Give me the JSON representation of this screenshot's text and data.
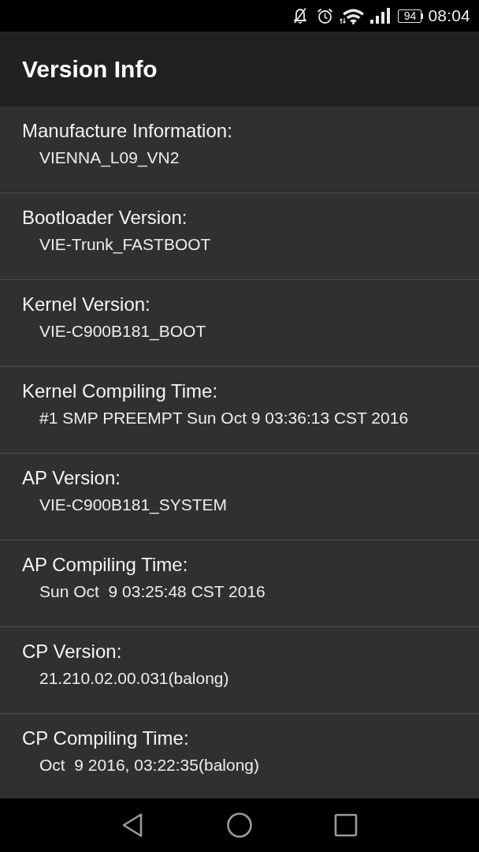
{
  "status_bar": {
    "battery": "94",
    "time": "08:04"
  },
  "app_bar": {
    "title": "Version Info"
  },
  "info_items": [
    {
      "label": "Manufacture Information:",
      "value": "VIENNA_L09_VN2"
    },
    {
      "label": "Bootloader Version:",
      "value": "VIE-Trunk_FASTBOOT"
    },
    {
      "label": "Kernel Version:",
      "value": "VIE-C900B181_BOOT"
    },
    {
      "label": "Kernel Compiling Time:",
      "value": "#1 SMP PREEMPT Sun Oct 9 03:36:13 CST 2016"
    },
    {
      "label": "AP Version:",
      "value": "VIE-C900B181_SYSTEM"
    },
    {
      "label": "AP Compiling Time:",
      "value": "Sun Oct  9 03:25:48 CST 2016"
    },
    {
      "label": "CP Version:",
      "value": "21.210.02.00.031(balong)"
    },
    {
      "label": "CP Compiling Time:",
      "value": "Oct  9 2016, 03:22:35(balong)"
    }
  ]
}
